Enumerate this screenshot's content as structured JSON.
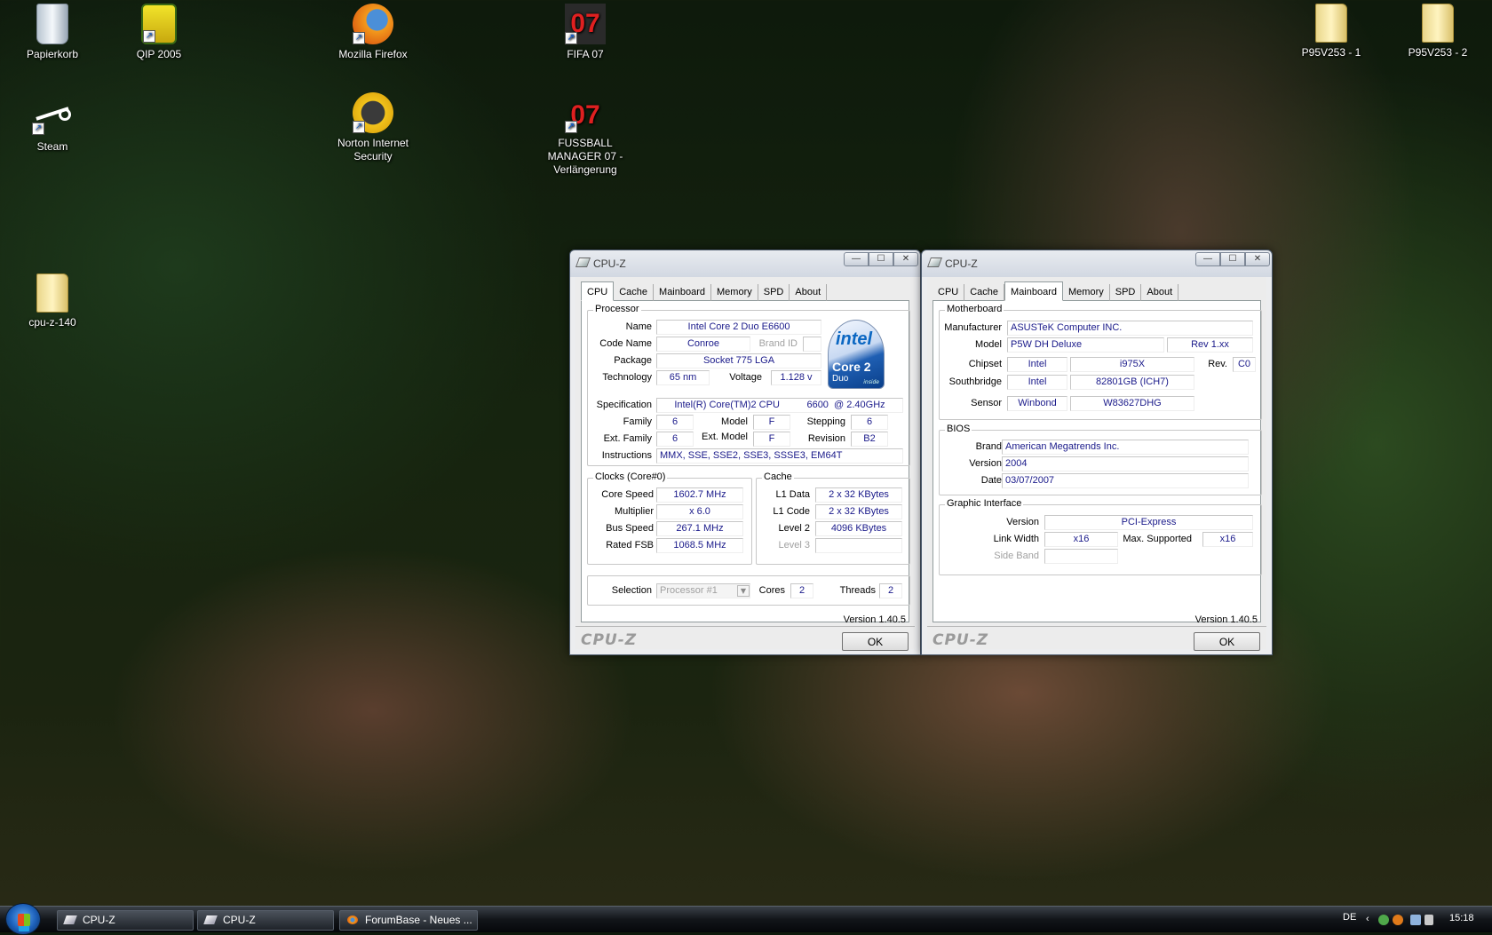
{
  "desktop": {
    "icons": [
      {
        "label": "Papierkorb",
        "name": "recycle-bin-icon"
      },
      {
        "label": "QIP 2005",
        "name": "qip-icon"
      },
      {
        "label": "Mozilla Firefox",
        "name": "firefox-icon"
      },
      {
        "label": "FIFA 07",
        "name": "fifa-icon"
      },
      {
        "label": "Steam",
        "name": "steam-icon"
      },
      {
        "label": "Norton Internet Security",
        "name": "norton-icon"
      },
      {
        "label": "FUSSBALL MANAGER 07 - Verlängerung",
        "name": "fussball-manager-icon"
      },
      {
        "label": "cpu-z-140",
        "name": "folder-icon"
      },
      {
        "label": "P95V253 - 1",
        "name": "folder-icon"
      },
      {
        "label": "P95V253 - 2",
        "name": "folder-icon"
      }
    ]
  },
  "common": {
    "title": "CPU-Z",
    "tabs": [
      "CPU",
      "Cache",
      "Mainboard",
      "Memory",
      "SPD",
      "About"
    ],
    "version": "Version 1.40.5",
    "logo": "CPU-Z",
    "ok": "OK",
    "min": "—",
    "max": "☐",
    "close": "✕"
  },
  "cpu": {
    "processor_title": "Processor",
    "labels": {
      "name": "Name",
      "codename": "Code Name",
      "brandid": "Brand ID",
      "package": "Package",
      "technology": "Technology",
      "voltage": "Voltage",
      "specification": "Specification",
      "family": "Family",
      "model": "Model",
      "stepping": "Stepping",
      "extfamily": "Ext. Family",
      "extmodel": "Ext. Model",
      "revision": "Revision",
      "instructions": "Instructions"
    },
    "name": "Intel Core 2 Duo E6600",
    "codename": "Conroe",
    "package": "Socket 775 LGA",
    "technology": "65 nm",
    "voltage": "1.128 v",
    "specification": "Intel(R) Core(TM)2 CPU          6600  @ 2.40GHz",
    "family": "6",
    "model": "F",
    "stepping": "6",
    "extfamily": "6",
    "extmodel": "F",
    "revision": "B2",
    "instructions": "MMX, SSE, SSE2, SSE3, SSSE3, EM64T",
    "badge": {
      "brand": "intel",
      "model": "Core 2",
      "sub": "Duo",
      "tiny": "inside"
    },
    "clocks_title": "Clocks (Core#0)",
    "clock_labels": {
      "corespeed": "Core Speed",
      "multiplier": "Multiplier",
      "busspeed": "Bus Speed",
      "ratedfsb": "Rated FSB"
    },
    "corespeed": "1602.7 MHz",
    "multiplier": "x 6.0",
    "busspeed": "267.1 MHz",
    "ratedfsb": "1068.5 MHz",
    "cache_title": "Cache",
    "cache_labels": {
      "l1data": "L1 Data",
      "l1code": "L1 Code",
      "level2": "Level 2",
      "level3": "Level 3"
    },
    "l1data": "2 x 32 KBytes",
    "l1code": "2 x 32 KBytes",
    "level2": "4096 KBytes",
    "selection_label": "Selection",
    "selection": "Processor #1",
    "cores_label": "Cores",
    "cores": "2",
    "threads_label": "Threads",
    "threads": "2"
  },
  "mainboard": {
    "mb_title": "Motherboard",
    "labels": {
      "manufacturer": "Manufacturer",
      "model": "Model",
      "chipset": "Chipset",
      "southbridge": "Southbridge",
      "sensor": "Sensor",
      "rev": "Rev."
    },
    "manufacturer": "ASUSTeK Computer INC.",
    "model": "P5W DH Deluxe",
    "model_rev": "Rev 1.xx",
    "chipset_vendor": "Intel",
    "chipset": "i975X",
    "chipset_rev": "C0",
    "sb_vendor": "Intel",
    "southbridge": "82801GB (ICH7)",
    "sensor_vendor": "Winbond",
    "sensor": "W83627DHG",
    "bios_title": "BIOS",
    "bios_labels": {
      "brand": "Brand",
      "version": "Version",
      "date": "Date"
    },
    "bios_brand": "American Megatrends Inc.",
    "bios_version": "2004",
    "bios_date": "03/07/2007",
    "gi_title": "Graphic Interface",
    "gi_labels": {
      "version": "Version",
      "linkwidth": "Link Width",
      "maxsupported": "Max. Supported",
      "sideband": "Side Band"
    },
    "gi_version": "PCI-Express",
    "gi_linkwidth": "x16",
    "gi_max": "x16"
  },
  "taskbar": {
    "buttons": [
      "CPU-Z",
      "CPU-Z",
      "ForumBase - Neues ..."
    ],
    "lang": "DE",
    "time": "15:18"
  }
}
